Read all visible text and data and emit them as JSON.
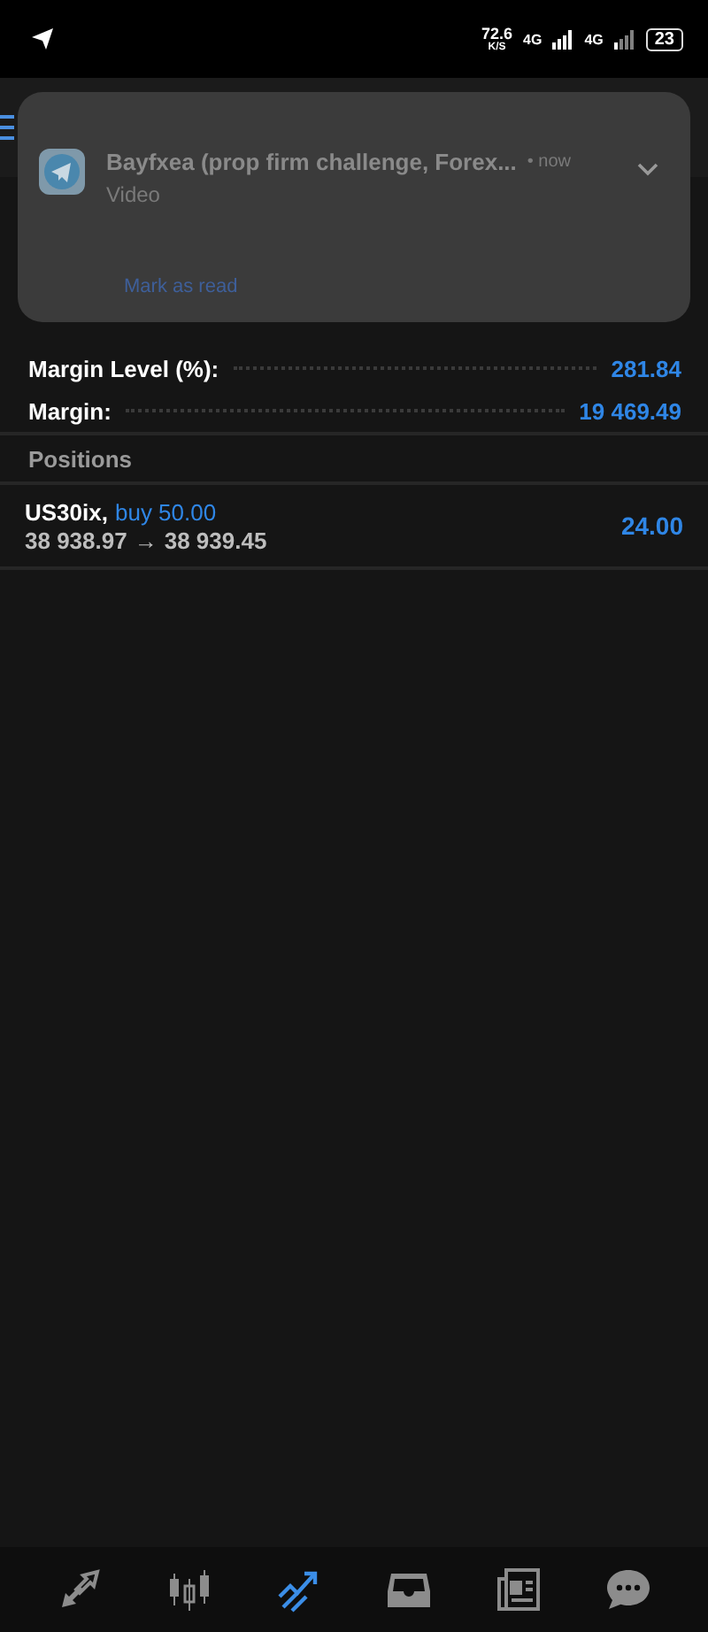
{
  "status_bar": {
    "speed": "72.6",
    "speed_unit": "K/S",
    "network_1": "4G",
    "network_2": "4G",
    "battery": "23"
  },
  "notification": {
    "title": "Bayfxea (prop firm challenge, Forex...",
    "time": "• now",
    "body": "Video",
    "action": "Mark as read"
  },
  "account_rows": [
    {
      "label": "Margin Level (%):",
      "value": "281.84"
    },
    {
      "label": "Margin:",
      "value": "19 469.49"
    }
  ],
  "positions_header": "Positions",
  "positions": [
    {
      "symbol": "US30ix,",
      "side": "buy 50.00",
      "open_price": "38 938.97",
      "arrow": "→",
      "current_price": "38 939.45",
      "profit": "24.00"
    }
  ],
  "nav": [
    {
      "kind": "trade",
      "selected": false
    },
    {
      "kind": "quotes",
      "selected": false
    },
    {
      "kind": "chart",
      "selected": true
    },
    {
      "kind": "inbox",
      "selected": false
    },
    {
      "kind": "news",
      "selected": false
    },
    {
      "kind": "chat",
      "selected": false
    }
  ]
}
